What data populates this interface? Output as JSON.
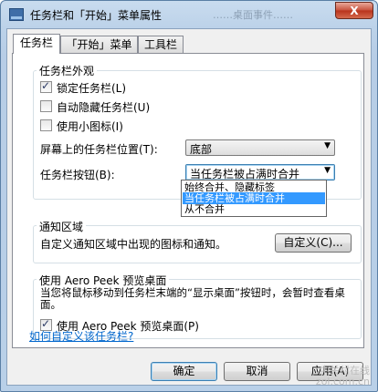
{
  "window": {
    "title": "任务栏和「开始」菜单属性",
    "background_title": "……桌面事件……",
    "close_glyph": "X"
  },
  "tabs": [
    {
      "label": "任务栏",
      "active": true
    },
    {
      "label": "「开始」菜单",
      "active": false
    },
    {
      "label": "工具栏",
      "active": false
    }
  ],
  "appearance": {
    "title": "任务栏外观",
    "lock": {
      "label": "锁定任务栏(L)",
      "checked": true
    },
    "autohide": {
      "label": "自动隐藏任务栏(U)",
      "checked": false
    },
    "small_icons": {
      "label": "使用小图标(I)",
      "checked": false
    },
    "position_label": "屏幕上的任务栏位置(T):",
    "position_value": "底部",
    "buttons_label": "任务栏按钮(B):",
    "buttons_value": "当任务栏被占满时合并",
    "buttons_options": [
      "始终合并、隐藏标签",
      "当任务栏被占满时合并",
      "从不合并"
    ],
    "buttons_highlighted": "当任务栏被占满时合并"
  },
  "notification": {
    "title": "通知区域",
    "description": "自定义通知区域中出现的图标和通知。",
    "customize_button": "自定义(C)..."
  },
  "aero": {
    "title": "使用 Aero Peek 预览桌面",
    "description": "当您将鼠标移动到任务栏末端的“显示桌面”按钮时，会暂时查看桌面。",
    "checkbox": {
      "label": "使用 Aero Peek 预览桌面(P)",
      "checked": true
    }
  },
  "help_link": "如何自定义该任务栏?",
  "buttons": {
    "ok": "确定",
    "cancel": "取消",
    "apply": "应用(A)"
  },
  "watermark": "中关村在线\nzol.com.cn",
  "colors": {
    "selection": "#3399ff",
    "link": "#0066cc",
    "title_bar": "#bcd2e9"
  }
}
